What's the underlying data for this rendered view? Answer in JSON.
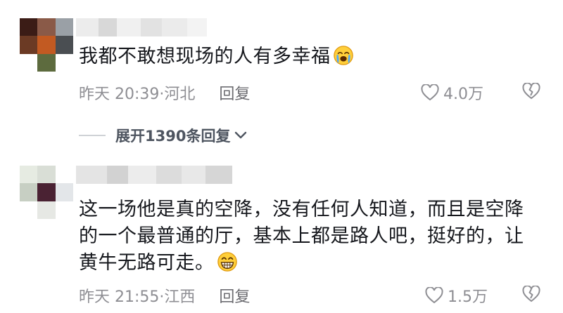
{
  "comments": [
    {
      "text": "我都不敢想现场的人有多幸福",
      "emoji": "loudly-crying-face-emoji",
      "time": "昨天 20:39",
      "location": "·河北",
      "reply_label": "回复",
      "likes": "4.0万"
    },
    {
      "text_lines": [
        "这一场他是真的空降，没有任何人知道，而且是空降",
        "的一个最普通的厅，基本上都是路人吧，挺好的，让",
        "黄牛无路可走。"
      ],
      "emoji": "grinning-face-emoji",
      "time": "昨天 21:55",
      "location": "·江西",
      "reply_label": "回复",
      "likes": "1.5万"
    }
  ],
  "expand_replies": {
    "label": "展开1390条回复"
  },
  "colors": {
    "text": "#16181d",
    "meta": "#8e8e93",
    "expand": "#4e5560",
    "icon_stroke": "#8e8e93"
  }
}
